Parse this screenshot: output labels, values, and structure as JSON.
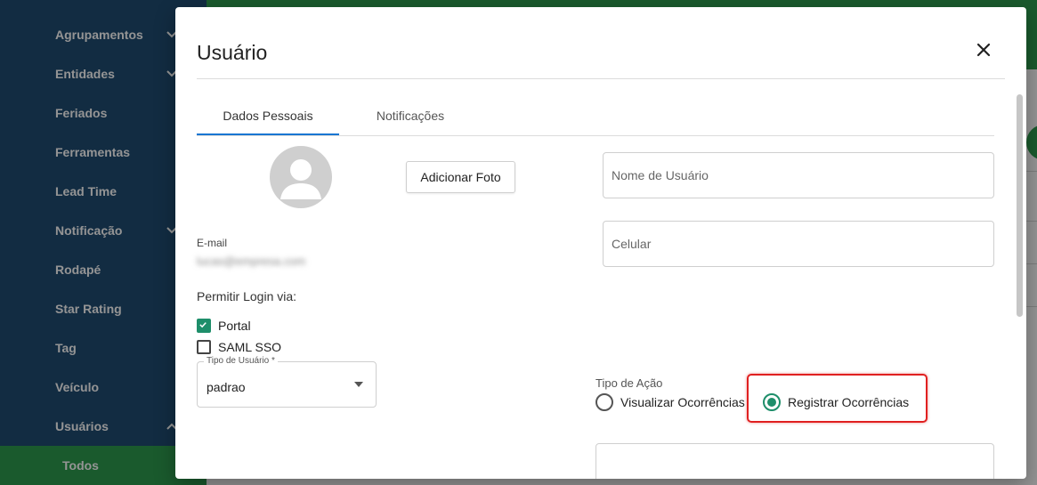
{
  "colors": {
    "sidebar_bg": "#1f4c73",
    "sidebar_active": "#2e9c4e",
    "topbar": "#2e9c4e",
    "accent_tab": "#1976d2",
    "control_accent": "#1e8e6a",
    "highlight": "#e02020"
  },
  "sidebar": {
    "items": [
      {
        "label": "Agrupamentos",
        "has_chevron": true
      },
      {
        "label": "Entidades",
        "has_chevron": true
      },
      {
        "label": "Feriados",
        "has_chevron": false
      },
      {
        "label": "Ferramentas",
        "has_chevron": false
      },
      {
        "label": "Lead Time",
        "has_chevron": false
      },
      {
        "label": "Notificação",
        "has_chevron": true
      },
      {
        "label": "Rodapé",
        "has_chevron": false
      },
      {
        "label": "Star Rating",
        "has_chevron": false
      },
      {
        "label": "Tag",
        "has_chevron": false
      },
      {
        "label": "Veículo",
        "has_chevron": false
      },
      {
        "label": "Usuários",
        "has_chevron": true,
        "expanded": true
      },
      {
        "label": "Todos",
        "active": true
      }
    ]
  },
  "dialog": {
    "title": "Usuário",
    "close_icon": "close-icon",
    "tabs": [
      {
        "label": "Dados Pessoais",
        "selected": true
      },
      {
        "label": "Notificações",
        "selected": false
      }
    ],
    "add_photo_label": "Adicionar Foto",
    "avatar_icon": "person-icon",
    "username_placeholder": "Nome de Usuário",
    "phone_placeholder": "Celular",
    "email_label": "E-mail",
    "email_value": "lucas@empresa.com",
    "login_via_label": "Permitir Login via:",
    "login_options": [
      {
        "label": "Portal",
        "checked": true
      },
      {
        "label": "SAML SSO",
        "checked": false
      }
    ],
    "user_type": {
      "legend": "Tipo de Usuário *",
      "value": "padrao"
    },
    "action_type": {
      "label": "Tipo de Ação",
      "options": [
        {
          "label": "Visualizar Ocorrências",
          "selected": false
        },
        {
          "label": "Registrar Ocorrências",
          "selected": true
        }
      ]
    }
  }
}
